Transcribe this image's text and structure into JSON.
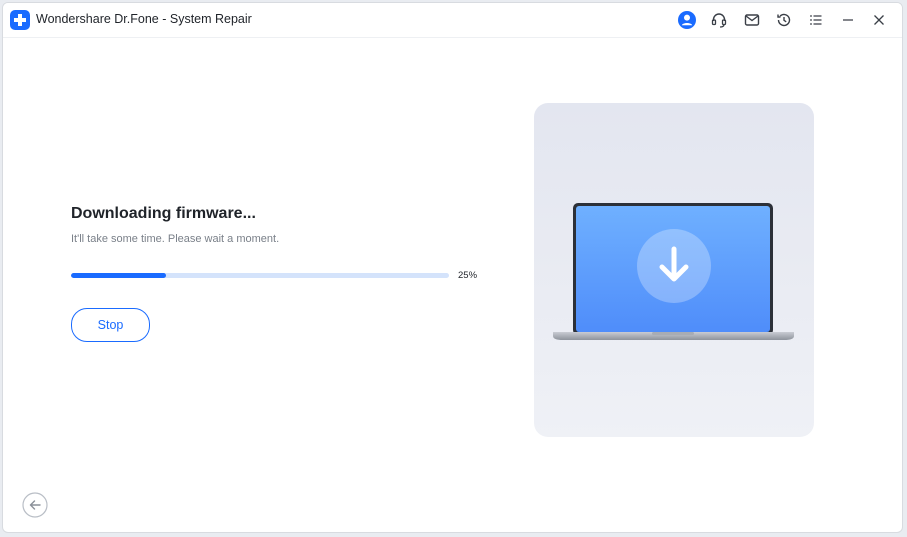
{
  "window": {
    "title": "Wondershare Dr.Fone - System Repair"
  },
  "titlebar": {
    "icons": [
      "account-icon",
      "support-headset-icon",
      "mail-icon",
      "history-icon",
      "menu-icon",
      "minimize-icon",
      "close-icon"
    ]
  },
  "main": {
    "heading": "Downloading firmware...",
    "subtext": "It'll take some time. Please wait a moment.",
    "progress": {
      "value": 0.25,
      "label": "25%"
    },
    "stop_label": "Stop"
  },
  "illustration": {
    "icon": "laptop-download-icon"
  },
  "footer": {
    "back_icon": "back-arrow-icon"
  },
  "colors": {
    "accent": "#1a6bff",
    "track": "#d4e3fb",
    "screen": "#5b9cff"
  }
}
